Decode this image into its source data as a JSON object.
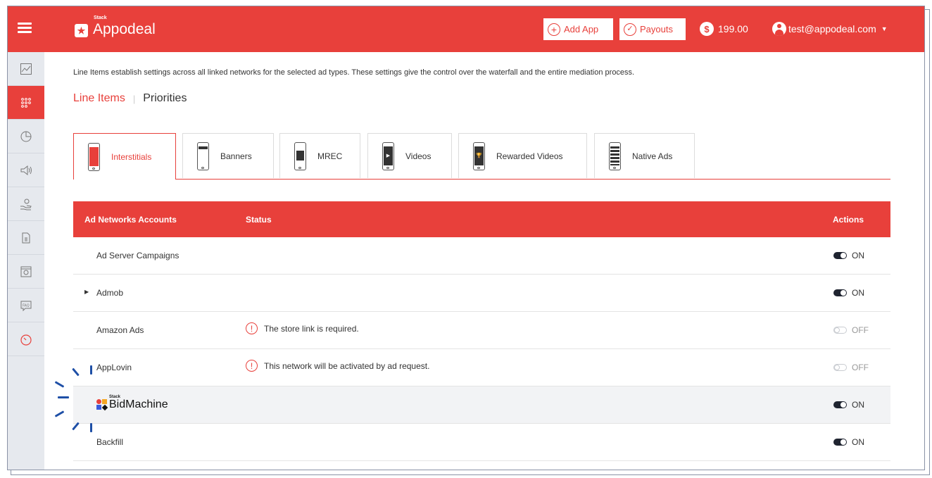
{
  "topbar": {
    "menu_icon": "hamburger-menu-icon",
    "logo_stack": "Stack",
    "logo_name": "Appodeal",
    "add_app": "Add App",
    "payouts": "Payouts",
    "balance": "199.00",
    "balance_icon": "dollar-coin-icon",
    "account_email": "test@appodeal.com",
    "colors": {
      "brand": "#e8403b",
      "sidebar": "#e6e9ee"
    }
  },
  "sidebar": {
    "items": [
      {
        "icon": "chart-line-icon",
        "active": false
      },
      {
        "icon": "apps-grid-icon",
        "active": true
      },
      {
        "icon": "pie-chart-icon",
        "active": false
      },
      {
        "icon": "megaphone-icon",
        "active": false
      },
      {
        "icon": "money-hand-icon",
        "active": false
      },
      {
        "icon": "document-icon",
        "active": false
      },
      {
        "icon": "settings-window-icon",
        "active": false
      },
      {
        "icon": "faq-icon",
        "active": false
      },
      {
        "icon": "speedometer-icon",
        "active": false
      }
    ]
  },
  "main": {
    "intro": "Line Items establish settings across all linked networks for the selected ad types. These settings give the control over the waterfall and the entire mediation process.",
    "subnav": {
      "line_items": "Line Items",
      "priorities": "Priorities"
    },
    "tabs": [
      {
        "label": "Interstitials",
        "active": true
      },
      {
        "label": "Banners",
        "active": false
      },
      {
        "label": "MREC",
        "active": false
      },
      {
        "label": "Videos",
        "active": false
      },
      {
        "label": "Rewarded Videos",
        "active": false
      },
      {
        "label": "Native Ads",
        "active": false
      }
    ],
    "table": {
      "headers": {
        "accounts": "Ad Networks Accounts",
        "status": "Status",
        "actions": "Actions"
      },
      "rows": [
        {
          "name": "Ad Server Campaigns",
          "status": "",
          "toggle": "ON"
        },
        {
          "name": "Admob",
          "status": "",
          "toggle": "ON",
          "expandable": true
        },
        {
          "name": "Amazon Ads",
          "status": "The store link is required.",
          "toggle": "OFF"
        },
        {
          "name": "AppLovin",
          "status": "This network will be activated by ad request.",
          "toggle": "OFF"
        },
        {
          "name": "BidMachine",
          "logo_stack": "Stack",
          "status": "",
          "toggle": "ON",
          "highlighted": true
        },
        {
          "name": "Backfill",
          "status": "",
          "toggle": "ON"
        }
      ]
    }
  }
}
